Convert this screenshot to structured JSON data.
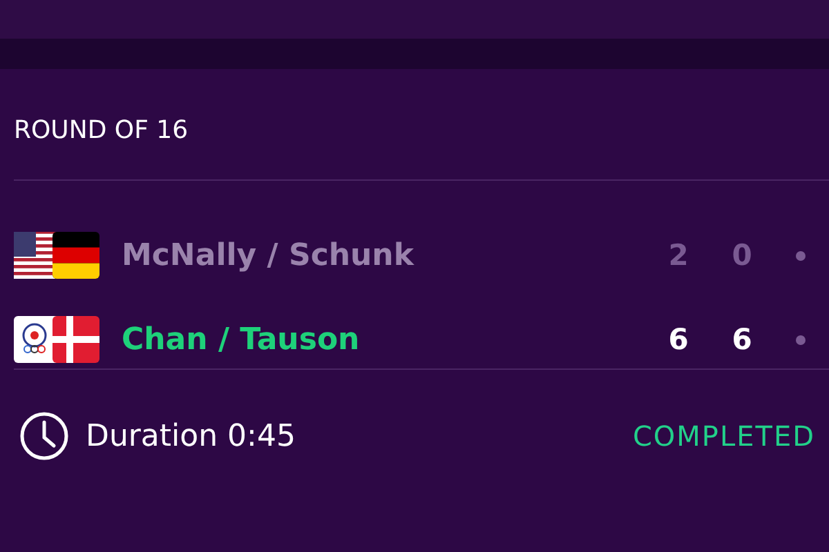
{
  "round": "ROUND OF 16",
  "teams": [
    {
      "name": "McNally / Schunk",
      "winner": false,
      "sets": [
        "2",
        "0"
      ],
      "serving": false
    },
    {
      "name": "Chan / Tauson",
      "winner": true,
      "sets": [
        "6",
        "6"
      ],
      "serving": false
    }
  ],
  "duration": "Duration 0:45",
  "status": "COMPLETED"
}
